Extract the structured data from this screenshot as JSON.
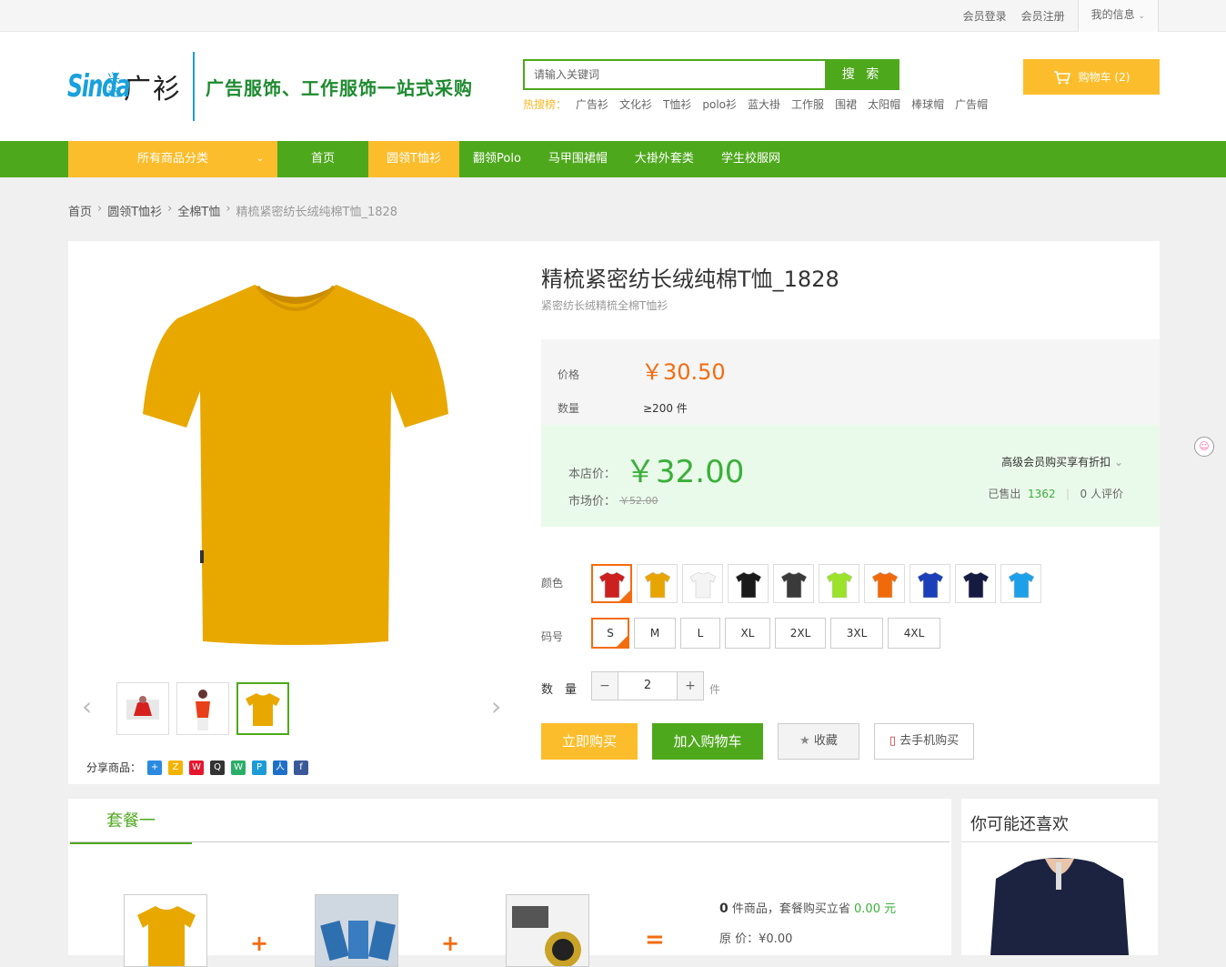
{
  "topbar": {
    "login": "会员登录",
    "register": "会员注册",
    "myinfo": "我的信息"
  },
  "logo": {
    "sinda": "Sinda",
    "xd": "兴达",
    "gs": "广衫",
    "slogan": "广告服饰、工作服饰一站式采购"
  },
  "search": {
    "placeholder": "请输入关键词",
    "button": "搜 索"
  },
  "hot": {
    "label": "热搜榜：",
    "terms": [
      "广告衫",
      "文化衫",
      "T恤衫",
      "polo衫",
      "蓝大褂",
      "工作服",
      "围裙",
      "太阳帽",
      "棒球帽",
      "广告帽"
    ]
  },
  "cart": {
    "label": "购物车 (2)"
  },
  "nav": {
    "category": "所有商品分类",
    "items": [
      "首页",
      "圆领T恤衫",
      "翻领Polo",
      "马甲围裙帽",
      "大褂外套类",
      "学生校服网"
    ]
  },
  "breadcrumb": {
    "items": [
      "首页",
      "圆领T恤衫",
      "全棉T恤"
    ],
    "current": "精梳紧密纺长绒纯棉T恤_1828"
  },
  "product": {
    "title": "精梳紧密纺长绒纯棉T恤_1828",
    "subtitle": "紧密纺长绒精梳全棉T恤衫",
    "price_label": "价格",
    "price": "￥30.50",
    "qty_label": "数量",
    "qty_value": "≥200 件",
    "store_label": "本店价：",
    "store_price": "￥32.00",
    "market_label": "市场价：",
    "market_price": "￥52.00",
    "vip": "高级会员购买享有折扣",
    "sold_label": "已售出",
    "sold": "1362",
    "reviews": "0 人评价",
    "color_label": "颜色",
    "size_label": "码号",
    "colors": [
      "#cc1f1f",
      "#e8a500",
      "#f4f4f4",
      "#1a1a1a",
      "#3a3a3a",
      "#9be22a",
      "#f06a0c",
      "#1a3fb8",
      "#151a40",
      "#1ea0e8"
    ],
    "sizes": [
      "S",
      "M",
      "L",
      "XL",
      "2XL",
      "3XL",
      "4XL"
    ],
    "quantity_label": "数　量",
    "quantity": "2",
    "unit": "件",
    "buy": "立即购买",
    "add_cart": "加入购物车",
    "fav": "收藏",
    "mobile": "去手机购买"
  },
  "share": {
    "label": "分享商品："
  },
  "combo": {
    "tab": "套餐一",
    "count": "0",
    "summary": " 件商品，套餐购买立省 ",
    "save": "0.00 元",
    "orig_label": "原 价：",
    "orig": "¥0.00"
  },
  "like": {
    "title": "你可能还喜欢"
  },
  "colors": {
    "green": "#4ea81c",
    "yellow": "#fcbd2c",
    "orange": "#f36c0f"
  }
}
